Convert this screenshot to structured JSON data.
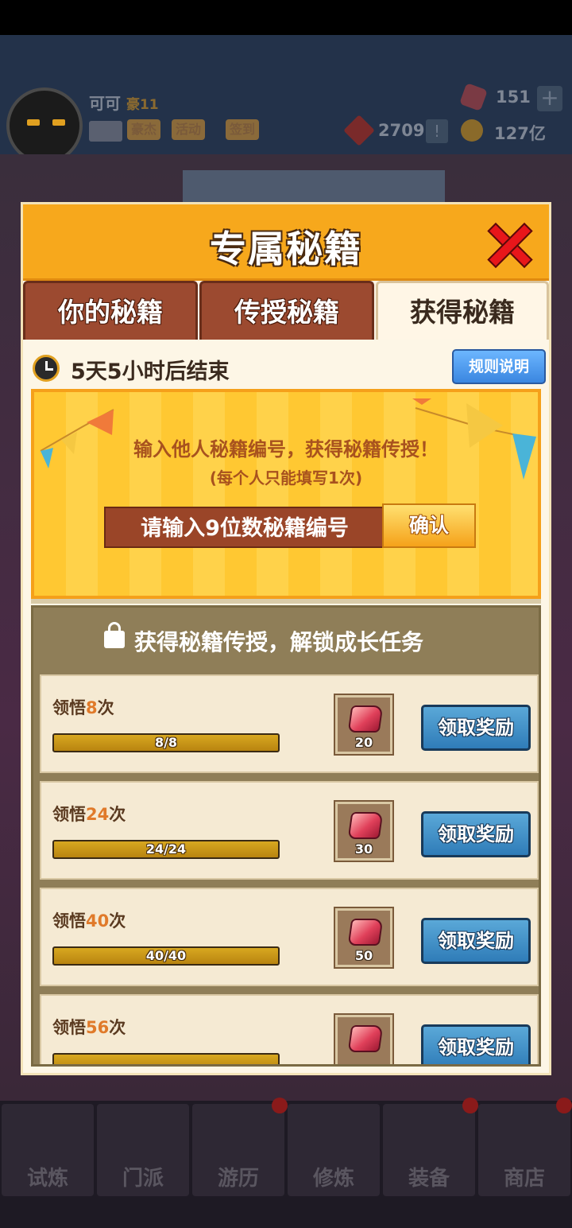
{
  "hud": {
    "username": "可可",
    "vip": "豪11",
    "tags": [
      "豪杰",
      "活动",
      "签到"
    ],
    "gems": "151",
    "medals": "2709",
    "coins": "127亿",
    "plus": "+",
    "alert": "!"
  },
  "dialog": {
    "title": "专属秘籍",
    "tabs": [
      "你的秘籍",
      "传授秘籍",
      "获得秘籍"
    ],
    "active_tab": "获得秘籍",
    "timer": "5天5小时后结束",
    "rules_button": "规则说明",
    "banner": {
      "line1": "输入他人秘籍编号，获得秘籍传授！",
      "line2": "(每个人只能填写1次)",
      "input_placeholder": "请输入9位数秘籍编号",
      "confirm": "确认"
    },
    "tasks_title": "获得秘籍传授，解锁成长任务",
    "tasks": [
      {
        "prefix": "领悟",
        "count": "8",
        "suffix": "次",
        "progress": "8/8",
        "reward_qty": "20",
        "claim": "领取奖励"
      },
      {
        "prefix": "领悟",
        "count": "24",
        "suffix": "次",
        "progress": "24/24",
        "reward_qty": "30",
        "claim": "领取奖励"
      },
      {
        "prefix": "领悟",
        "count": "40",
        "suffix": "次",
        "progress": "40/40",
        "reward_qty": "50",
        "claim": "领取奖励"
      },
      {
        "prefix": "领悟",
        "count": "56",
        "suffix": "次",
        "progress": "",
        "reward_qty": "",
        "claim": "领取奖励"
      }
    ]
  },
  "bottom_nav": [
    "试炼",
    "门派",
    "游历",
    "修炼",
    "装备",
    "商店"
  ],
  "colors": {
    "header": "#f7a81c",
    "tab": "#9c4a30",
    "claim_button": "#2f7cb8",
    "banner": "#ffc832"
  }
}
